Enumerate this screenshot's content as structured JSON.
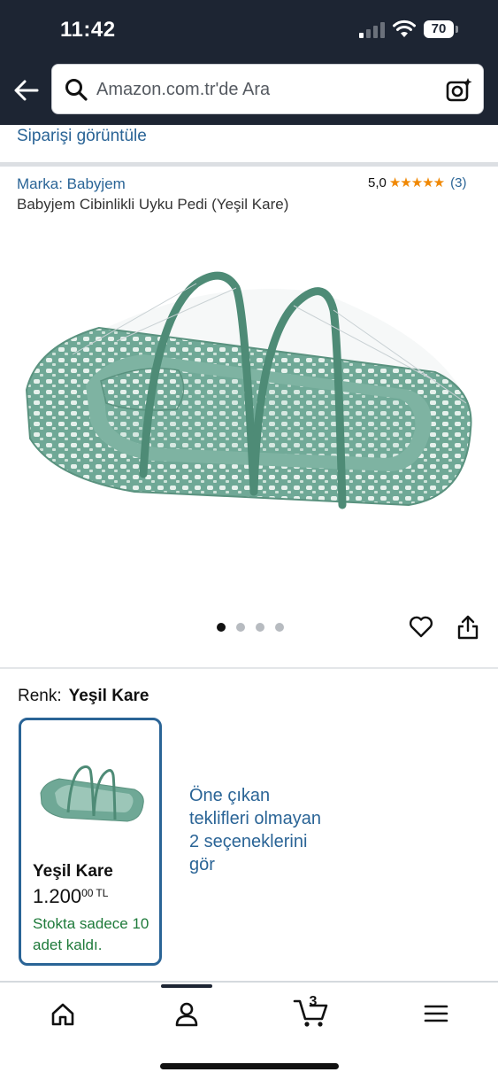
{
  "status_bar": {
    "time": "11:42",
    "battery": "70"
  },
  "header": {
    "search_placeholder": "Amazon.com.tr'de Ara"
  },
  "order_link": "Siparişi görüntüle",
  "product": {
    "brand": "Marka: Babyjem",
    "rating_value": "5,0",
    "stars": "★★★★★",
    "rating_count": "(3)",
    "title": "Babyjem Cibinlikli Uyku Pedi (Yeşil Kare)"
  },
  "gallery": {
    "total_images": 4,
    "active_index": 0
  },
  "color": {
    "label": "Renk:",
    "value": "Yeşil Kare"
  },
  "variant": {
    "name": "Yeşil Kare",
    "price_main": "1.200",
    "price_fraction": "00",
    "currency": "TL",
    "stock": "Stokta sadece 10 adet kaldı."
  },
  "other_options_link": "Öne çıkan teklifleri olmayan 2 seçeneklerini gör",
  "bottom_nav": {
    "cart_count": "3",
    "items": [
      "home-icon",
      "account-icon",
      "cart-icon",
      "menu-icon"
    ]
  },
  "colors": {
    "header_bg": "#1d2533",
    "link": "#2a6496",
    "star": "#f08804",
    "in_stock": "#1e7a3a",
    "card_border": "#2a6496"
  }
}
